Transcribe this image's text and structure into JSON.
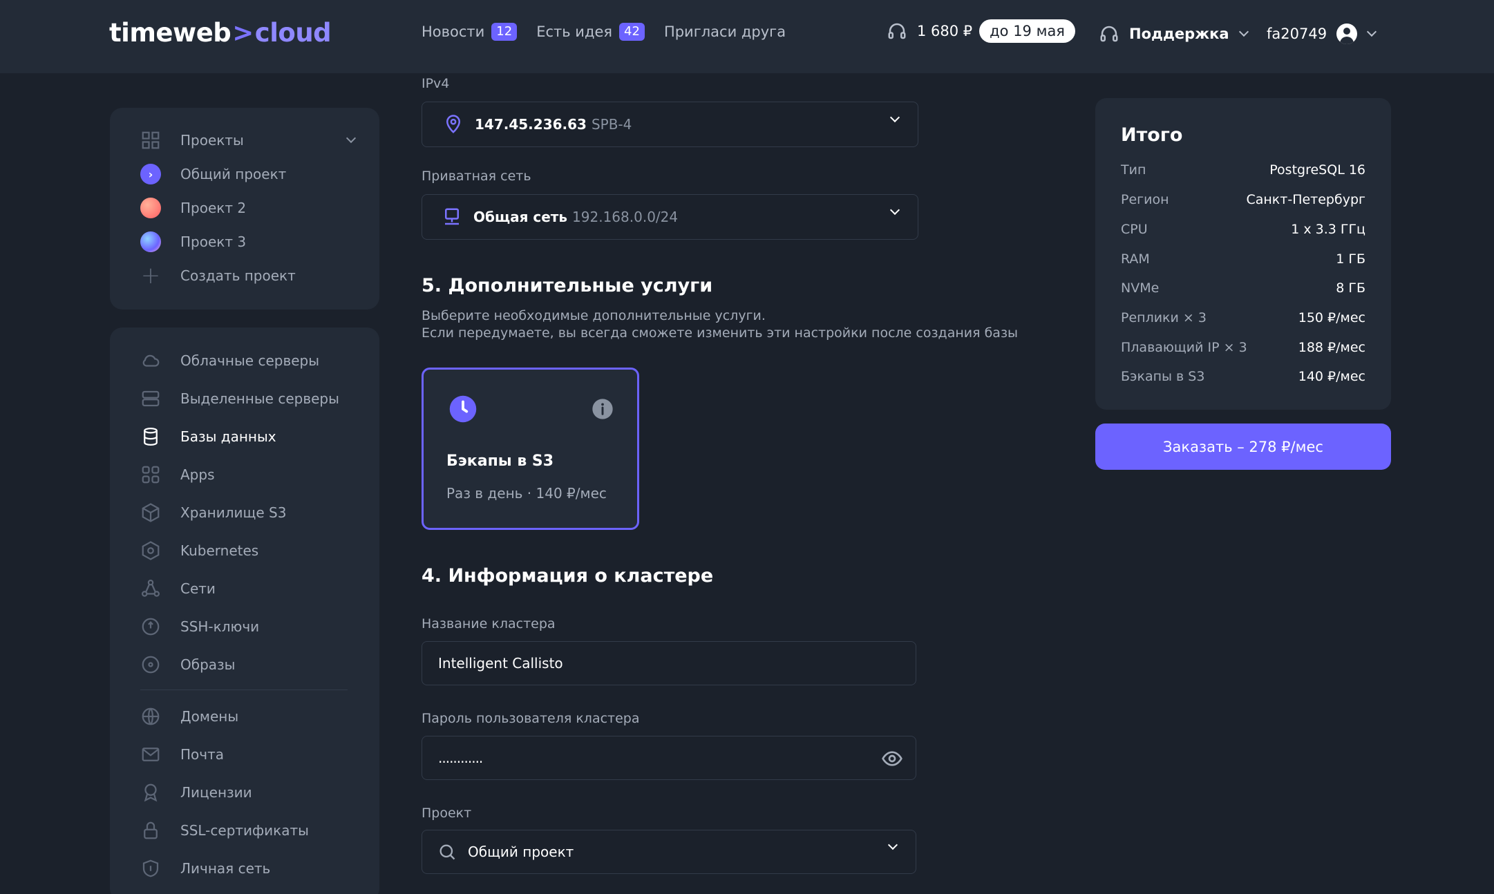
{
  "header": {
    "logo_main": "timeweb",
    "logo_arrow": ">",
    "logo_cloud": "cloud",
    "nav": [
      {
        "label": "Новости",
        "badge": "12"
      },
      {
        "label": "Есть идея",
        "badge": "42"
      },
      {
        "label": "Пригласи друга"
      }
    ],
    "balance": "1 680 ₽",
    "balance_until": "до 19 мая",
    "support_label": "Поддержка",
    "username": "fa20749"
  },
  "sidebar": {
    "projects_header": "Проекты",
    "projects": [
      {
        "label": "Общий проект"
      },
      {
        "label": "Проект 2"
      },
      {
        "label": "Проект 3"
      }
    ],
    "create_project": "Создать проект",
    "services": [
      {
        "label": "Облачные серверы",
        "icon": "cloud-icon"
      },
      {
        "label": "Выделенные серверы",
        "icon": "server-icon"
      },
      {
        "label": "Базы данных",
        "icon": "database-icon",
        "active": true
      },
      {
        "label": "Apps",
        "icon": "apps-icon"
      },
      {
        "label": "Хранилище S3",
        "icon": "box-icon"
      },
      {
        "label": "Kubernetes",
        "icon": "kubernetes-icon"
      },
      {
        "label": "Сети",
        "icon": "network-icon"
      },
      {
        "label": "SSH-ключи",
        "icon": "key-icon"
      },
      {
        "label": "Образы",
        "icon": "disk-icon"
      }
    ],
    "extra": [
      {
        "label": "Домены",
        "icon": "globe-icon"
      },
      {
        "label": "Почта",
        "icon": "mail-icon"
      },
      {
        "label": "Лицензии",
        "icon": "license-icon"
      },
      {
        "label": "SSL-сертификаты",
        "icon": "lock-icon"
      },
      {
        "label": "Личная сеть",
        "icon": "shield-icon"
      }
    ]
  },
  "main": {
    "ipv4_label": "IPv4",
    "ipv4_value": "147.45.236.63",
    "ipv4_region": "SPB-4",
    "private_net_label": "Приватная сеть",
    "private_net_value": "Общая сеть",
    "private_net_cidr": "192.168.0.0/24",
    "section5_title": "5. Дополнительные услуги",
    "section5_desc_1": "Выберите необходимые дополнительные услуги.",
    "section5_desc_2": "Если передумаете, вы всегда сможете изменить эти настройки после создания базы",
    "backup_card_title": "Бэкапы в S3",
    "backup_card_sub": "Раз в день · 140 ₽/мес",
    "section4_title": "4. Информация о кластере",
    "cluster_name_label": "Название кластера",
    "cluster_name_value": "Intelligent Callisto",
    "password_label": "Пароль пользователя кластера",
    "password_value": "............",
    "project_label": "Проект",
    "project_value": "Общий проект"
  },
  "summary": {
    "title": "Итого",
    "rows": [
      {
        "k": "Тип",
        "v": "PostgreSQL 16"
      },
      {
        "k": "Регион",
        "v": "Санкт-Петербург"
      },
      {
        "k": "CPU",
        "v": "1 x 3.3 ГГц"
      },
      {
        "k": "RAM",
        "v": "1 ГБ"
      },
      {
        "k": "NVMe",
        "v": "8 ГБ"
      },
      {
        "k": "Реплики × 3",
        "v": "150 ₽/мес"
      },
      {
        "k": "Плавающий IP × 3",
        "v": "188 ₽/мес"
      },
      {
        "k": "Бэкапы в S3",
        "v": "140 ₽/мес"
      }
    ],
    "order_button": "Заказать – 278 ₽/мес"
  },
  "colors": {
    "bg": "#1b212b",
    "panel": "#232b37",
    "accent": "#6c63ff"
  }
}
